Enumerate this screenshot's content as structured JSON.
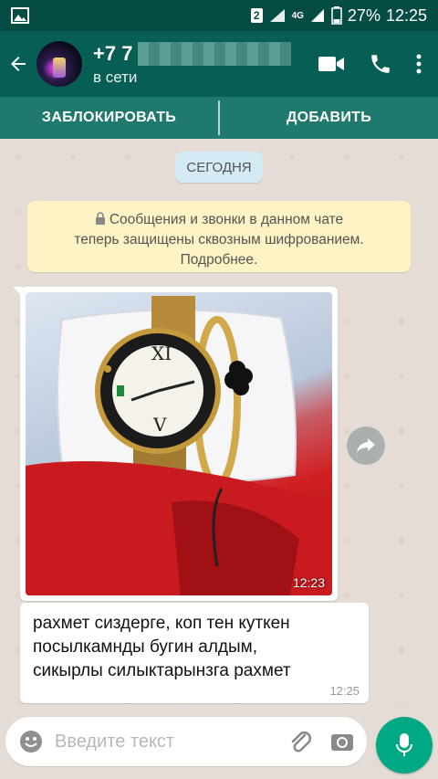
{
  "status": {
    "sim_badge": "2",
    "network": "4G",
    "battery": "27%",
    "time": "12:25"
  },
  "header": {
    "phone_prefix": "+7 7",
    "status": "в сети"
  },
  "block_bar": {
    "block_label": "ЗАБЛОКИРОВАТЬ",
    "add_label": "ДОБАВИТЬ"
  },
  "chat": {
    "date_chip": "СЕГОДНЯ",
    "encryption_line1": "Сообщения и звонки в данном чате",
    "encryption_line2": "теперь защищены сквозным шифрованием.",
    "encryption_line3": "Подробнее.",
    "image_time": "12:23",
    "text_line1": "рахмет сиздерге, коп тен куткен",
    "text_line2": "посылкамнды бугин алдым,",
    "text_line3": "сикырлы силыктарынзга рахмет",
    "text_time": "12:25"
  },
  "input": {
    "placeholder": "Введите текст"
  },
  "colors": {
    "header": "#075e54",
    "status_bar": "#054d44",
    "accent": "#00a884",
    "chat_bg": "#e5ddd5"
  }
}
